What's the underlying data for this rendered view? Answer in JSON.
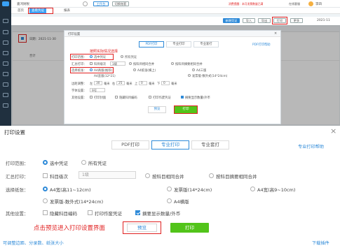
{
  "app": {
    "title": "嘉鸿财税",
    "menu_label": "工作台",
    "switch_label": "切换账套",
    "topbar_notice": "消费提醒：本月发票数量已满",
    "topbar_online": "在线客服",
    "topbar_user": "李四",
    "tab_home": "首页",
    "tab_voucher": "查看凭证",
    "tab_report": "报表",
    "toolbar_add": "新增凭证",
    "toolbar_import": "导入",
    "toolbar_export": "导出",
    "toolbar_print": "打印",
    "toolbar_more": "更多",
    "period_label": "2021-11",
    "row_date": "日期：2021-11-30",
    "row_subtotal": "合计",
    "mini_dialog": {
      "title": "打印设置",
      "tab_pdf": "PDF打印",
      "tab_pro": "专业打印",
      "tab_set": "专业套打",
      "help_link": "PDF打印帮助",
      "annotation": "按照实际情况选择",
      "range_label": "打印范围：",
      "range_opt1": "选中凭证",
      "range_opt2": "所有凭证",
      "summary_label": "汇总打印：",
      "summary_opt1": "科目级次",
      "summary_level": "1级",
      "summary_opt2": "按科目相同合并",
      "summary_opt3": "按科目摘要相同合并",
      "paper_label": "选择纸张：",
      "paper_opt1": "A4两版(推荐)",
      "paper_opt2": "A4纸张(横上)",
      "paper_opt3": "A4三版",
      "paper_opt4": "A4竖版(12*21)",
      "paper_opt5": "发票版-数外式(14*24cm)",
      "margin_label": "边距调整：",
      "margin_left": "左",
      "margin_left_val": "30",
      "margin_right": "右",
      "margin_right_val": "25",
      "margin_top": "上",
      "margin_top_val": "0",
      "margin_bottom": "下",
      "margin_bottom_val": "0",
      "margin_unit": "毫米",
      "font_label": "字体设置：",
      "font_val": "9号",
      "other_label": "其他设置：",
      "other_opt1": "打印封面",
      "other_opt2": "隐藏科目编码",
      "other_opt3": "打印作废凭证",
      "other_opt4": "摘要显示数量/外币",
      "preview_btn": "预览",
      "print_btn": "打印"
    }
  },
  "dialog": {
    "title": "打印设置",
    "close_icon": "close-icon",
    "tabs": [
      {
        "label": "PDF打印",
        "active": false
      },
      {
        "label": "专业打印",
        "active": true
      },
      {
        "label": "专业套打",
        "active": false
      }
    ],
    "help_link": "专业打印帮助",
    "range_label": "打印范围：",
    "range_options": [
      {
        "label": "选中凭证",
        "selected": true
      },
      {
        "label": "所有凭证",
        "selected": false
      }
    ],
    "summary_label": "汇总打印：",
    "summary_level_check": "科目级次",
    "summary_level_value": "1级",
    "summary_merge_opt1": "按科目相同合并",
    "summary_merge_opt2": "按科目摘要相同合并",
    "paper_label": "选择纸张：",
    "paper_options": [
      {
        "label": "A4宽(高11~12cm)",
        "selected": true
      },
      {
        "label": "发票版(14*24cm)",
        "selected": false
      },
      {
        "label": "A4宽(高9~10cm)",
        "selected": false
      },
      {
        "label": "发票版-数外式(14*24cm)",
        "selected": false
      },
      {
        "label": "A4横版",
        "selected": false
      }
    ],
    "other_label": "其他设置：",
    "other_options": [
      {
        "label": "隐藏科目编码",
        "checked": false
      },
      {
        "label": "打印作废凭证",
        "checked": false
      },
      {
        "label": "摘要显示数量/外币",
        "checked": true
      }
    ],
    "annotation": "点击预览进入打印设置界面",
    "preview_btn": "预览",
    "print_btn": "打印",
    "footer_left": "可调整边距、分录数、纸张大小",
    "footer_right": "下载插件"
  },
  "colors": {
    "accent": "#2e8ad8",
    "annotation": "#e02020",
    "print_btn": "#52c41a",
    "sidebar": "#20303f"
  }
}
